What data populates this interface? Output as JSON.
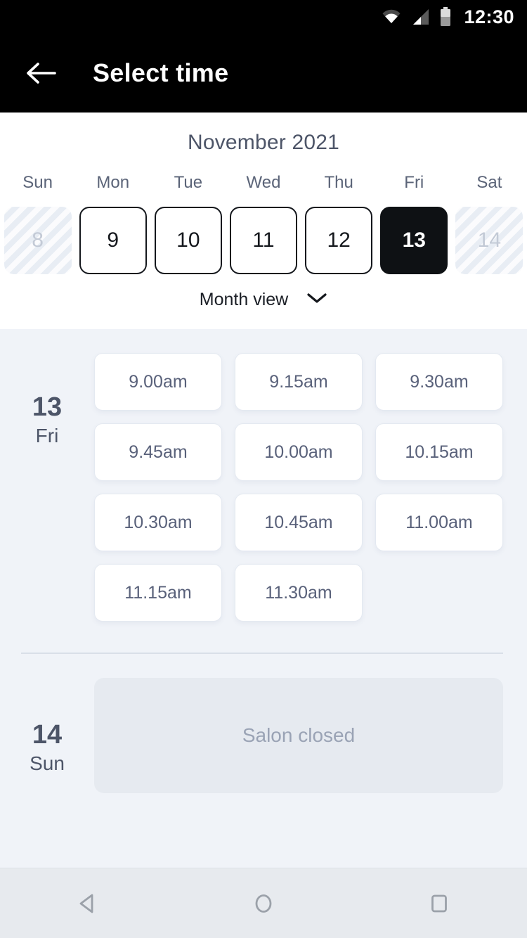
{
  "statusbar": {
    "time": "12:30",
    "icons": [
      "wifi-icon",
      "cellular-signal-icon",
      "battery-icon"
    ]
  },
  "appbar": {
    "back_icon": "back-arrow-icon",
    "title": "Select time"
  },
  "calendar": {
    "month_title": "November 2021",
    "weekdays": [
      "Sun",
      "Mon",
      "Tue",
      "Wed",
      "Thu",
      "Fri",
      "Sat"
    ],
    "days": [
      {
        "num": "8",
        "state": "disabled"
      },
      {
        "num": "9",
        "state": "available"
      },
      {
        "num": "10",
        "state": "available"
      },
      {
        "num": "11",
        "state": "available"
      },
      {
        "num": "12",
        "state": "available"
      },
      {
        "num": "13",
        "state": "selected"
      },
      {
        "num": "14",
        "state": "disabled"
      }
    ],
    "view_toggle": {
      "label": "Month view",
      "icon": "chevron-down-icon"
    }
  },
  "schedule": [
    {
      "day_number": "13",
      "day_of_week": "Fri",
      "slots": [
        "9.00am",
        "9.15am",
        "9.30am",
        "9.45am",
        "10.00am",
        "10.15am",
        "10.30am",
        "10.45am",
        "11.00am",
        "11.15am",
        "11.30am"
      ]
    },
    {
      "day_number": "14",
      "day_of_week": "Sun",
      "closed_message": "Salon closed"
    }
  ],
  "navbar": {
    "back": "android-back-icon",
    "home": "android-home-icon",
    "recents": "android-recents-icon"
  },
  "colors": {
    "appbar_bg": "#000000",
    "content_bg": "#f0f3f8",
    "selected_day_bg": "#0e1114",
    "text_slate": "#4d5568",
    "closed_box_bg": "#e6eaf0"
  }
}
